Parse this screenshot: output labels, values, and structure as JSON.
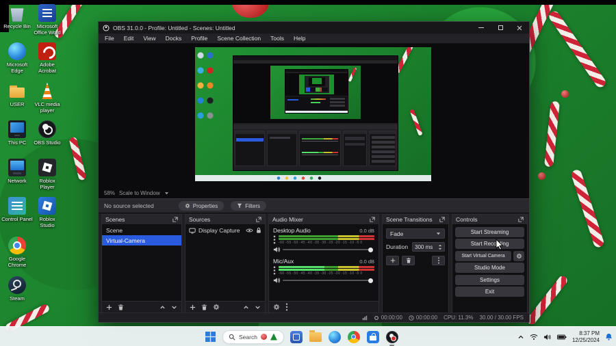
{
  "desktop": {
    "icons_left": [
      "Recycle Bin",
      "Microsoft Edge",
      "USER",
      "This PC",
      "Network",
      "Control Panel",
      "Google Chrome",
      "Steam"
    ],
    "icons_right": [
      "Microsoft Office Word",
      "Adobe Acrobat",
      "VLC media player",
      "OBS Studio",
      "Roblox Player",
      "Roblox Studio"
    ]
  },
  "obs": {
    "title": "OBS 31.0.0 - Profile: Untitled - Scenes: Untitled",
    "menus": [
      "File",
      "Edit",
      "View",
      "Docks",
      "Profile",
      "Scene Collection",
      "Tools",
      "Help"
    ],
    "preview": {
      "zoom_pct": "58%",
      "scale_mode": "Scale to Window"
    },
    "source_bar": {
      "message": "No source selected",
      "properties_label": "Properties",
      "filters_label": "Filters"
    },
    "scenes": {
      "title": "Scenes",
      "items": [
        "Scene",
        "Virtual-Camera"
      ]
    },
    "sources": {
      "title": "Sources",
      "items": [
        "Display Capture"
      ]
    },
    "mixer": {
      "title": "Audio Mixer",
      "channels": [
        {
          "name": "Desktop Audio",
          "level": "0.0 dB"
        },
        {
          "name": "Mic/Aux",
          "level": "0.0 dB"
        }
      ],
      "scale_ticks": "-60 -55 -50 -45 -40 -35 -30 -25 -20 -15 -10 -5 0"
    },
    "transitions": {
      "title": "Scene Transitions",
      "current": "Fade",
      "duration_label": "Duration",
      "duration": "300 ms"
    },
    "controls": {
      "title": "Controls",
      "buttons": [
        "Start Streaming",
        "Start Recording",
        "Start Virtual Camera",
        "Studio Mode",
        "Settings",
        "Exit"
      ]
    },
    "status": {
      "recording_time": "00:00:00",
      "streaming_time": "00:00:00",
      "cpu": "CPU: 11.3%",
      "fps": "30.00 / 30.00 FPS"
    }
  },
  "taskbar": {
    "search_label": "Search",
    "time": "8:37 PM",
    "date": "12/25/2024"
  },
  "colors": {
    "accent_blue": "#2a5ade",
    "cane_red": "#cf2438",
    "wallpaper_green": "#1d8f2c"
  }
}
